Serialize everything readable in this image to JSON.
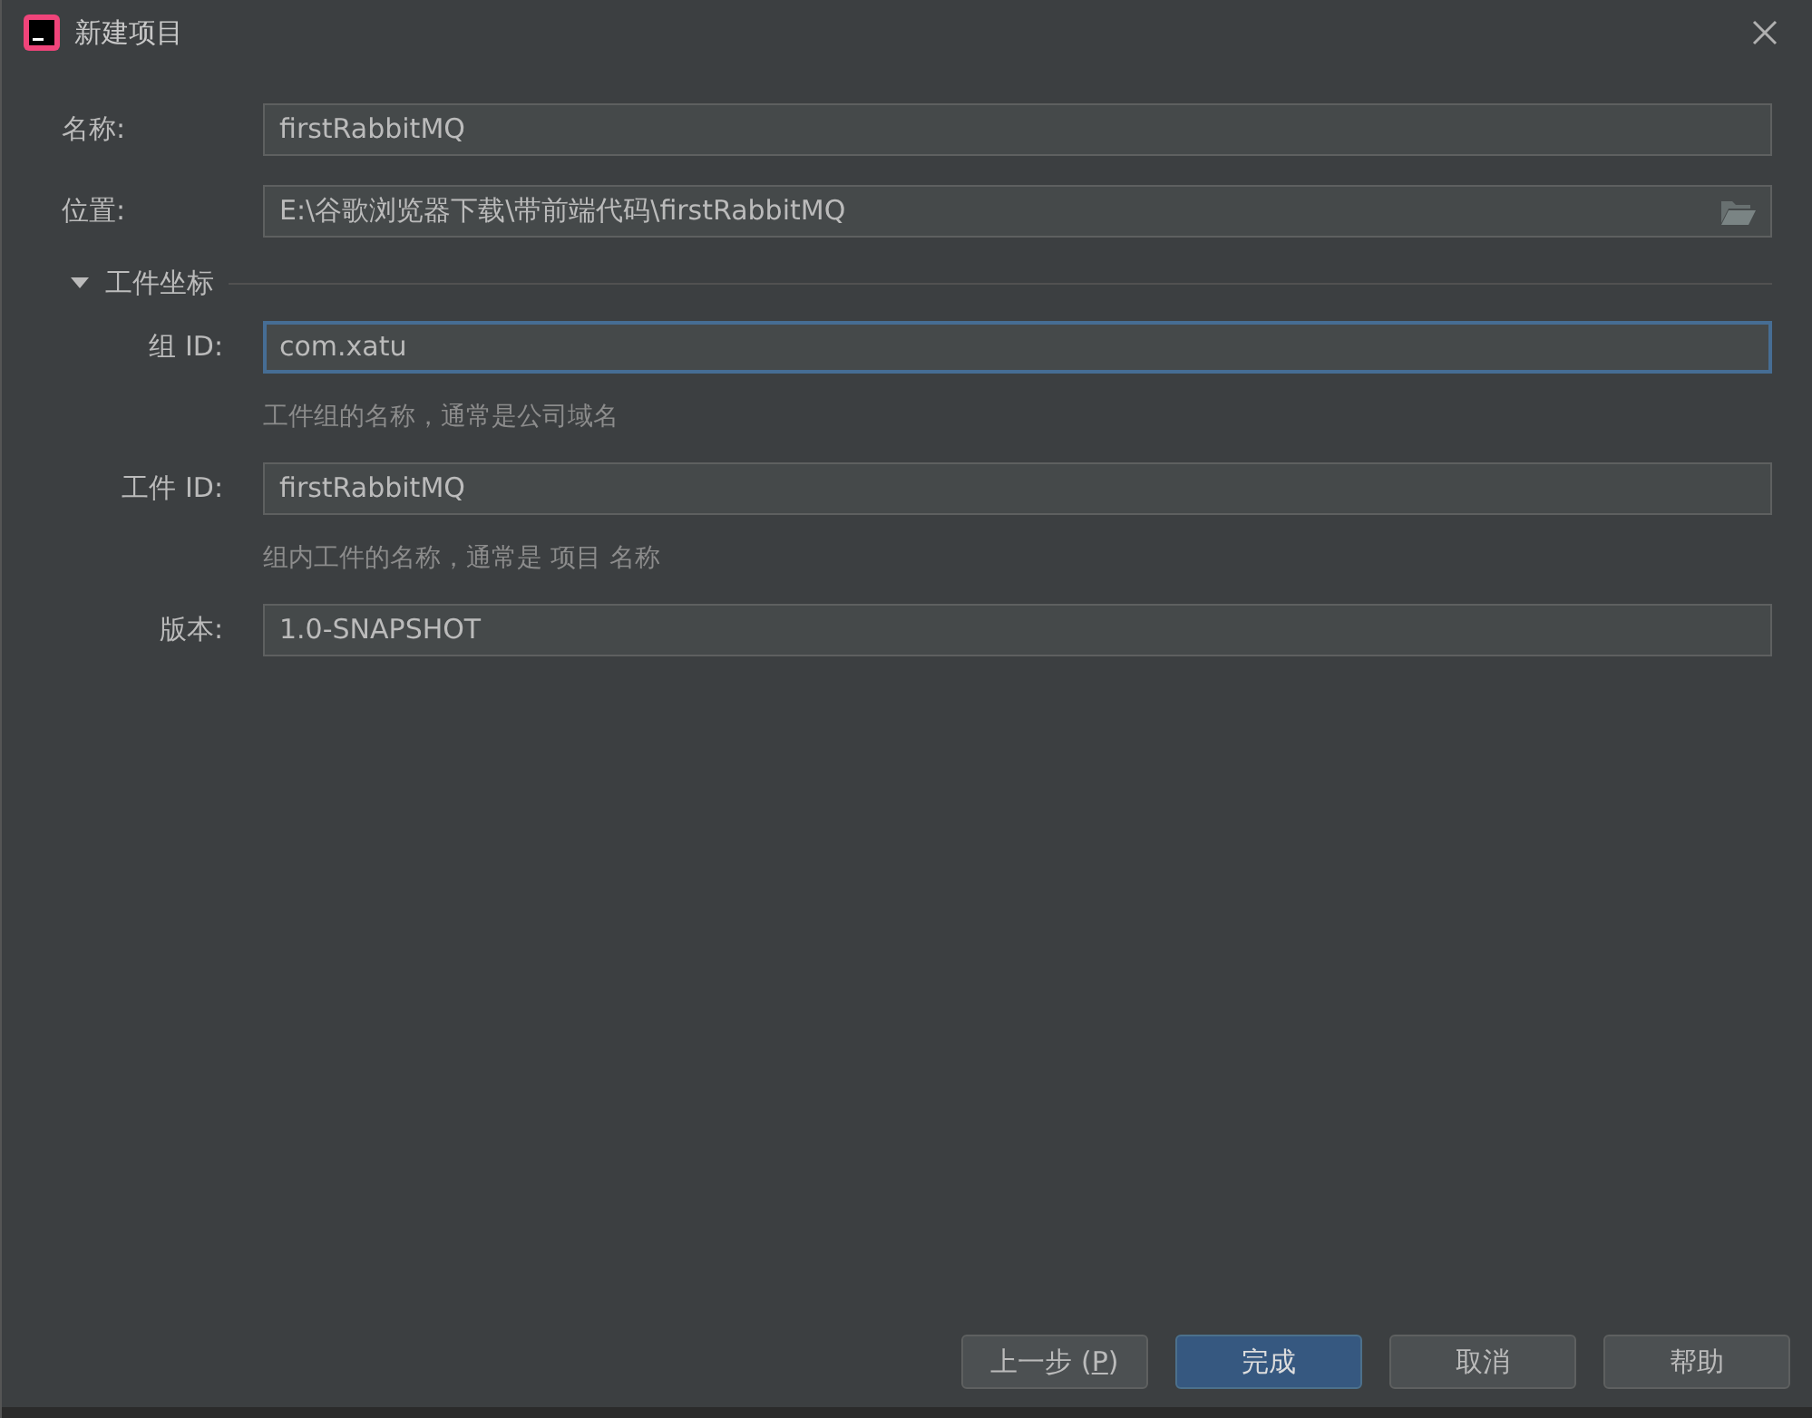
{
  "window": {
    "title": "新建项目"
  },
  "fields": [
    {
      "label": "名称:",
      "value": "firstRabbitMQ",
      "kind": "text",
      "focused": false
    },
    {
      "label": "位置:",
      "value": "E:\\谷歌浏览器下载\\带前端代码\\firstRabbitMQ",
      "kind": "folder",
      "focused": false
    }
  ],
  "section": {
    "title": "工件坐标",
    "expanded": true,
    "fields": [
      {
        "label": "组 ID:",
        "value": "com.xatu",
        "hint": "工件组的名称，通常是公司域名",
        "focused": true
      },
      {
        "label": "工件 ID:",
        "value": "firstRabbitMQ",
        "hint": "组内工件的名称，通常是 项目 名称",
        "focused": false
      },
      {
        "label": "版本:",
        "value": "1.0-SNAPSHOT",
        "focused": false
      }
    ]
  },
  "buttons": [
    {
      "label": "上一步 (",
      "mnemonic": "P",
      "suffix": ")",
      "primary": false
    },
    {
      "label": "完成",
      "primary": true
    },
    {
      "label": "取消",
      "primary": false
    },
    {
      "label": "帮助",
      "primary": false
    }
  ]
}
